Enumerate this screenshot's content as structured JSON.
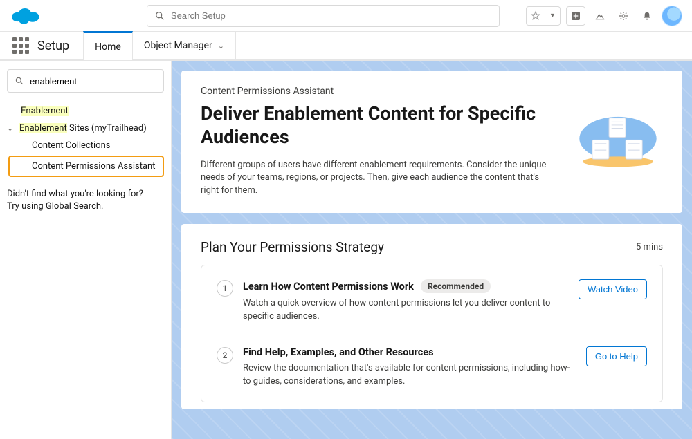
{
  "header": {
    "search_placeholder": "Search Setup"
  },
  "context": {
    "app_title": "Setup",
    "tabs": {
      "home": "Home",
      "object_manager": "Object Manager"
    }
  },
  "sidebar": {
    "search_value": "enablement",
    "items": {
      "enablement": "Enablement",
      "enablement_sites_prefix": "Enablement",
      "enablement_sites_suffix": " Sites (myTrailhead)",
      "content_collections": "Content Collections",
      "content_permissions_assistant": "Content Permissions Assistant"
    },
    "help_line1": "Didn't find what you're looking for?",
    "help_line2": "Try using Global Search."
  },
  "hero": {
    "eyebrow": "Content Permissions Assistant",
    "title": "Deliver Enablement Content for Specific Audiences",
    "description": "Different groups of users have different enablement requirements. Consider the unique needs of your teams, regions, or projects. Then, give each audience the content that's right for them."
  },
  "plan": {
    "title": "Plan Your Permissions Strategy",
    "duration": "5 mins",
    "steps": [
      {
        "num": "1",
        "title": "Learn How Content Permissions Work",
        "badge": "Recommended",
        "desc": "Watch a quick overview of how content permissions let you deliver content to specific audiences.",
        "action": "Watch Video"
      },
      {
        "num": "2",
        "title": "Find Help, Examples, and Other Resources",
        "badge": "",
        "desc": "Review the documentation that's available for content permissions, including how-to guides, considerations, and examples.",
        "action": "Go to Help"
      }
    ]
  }
}
